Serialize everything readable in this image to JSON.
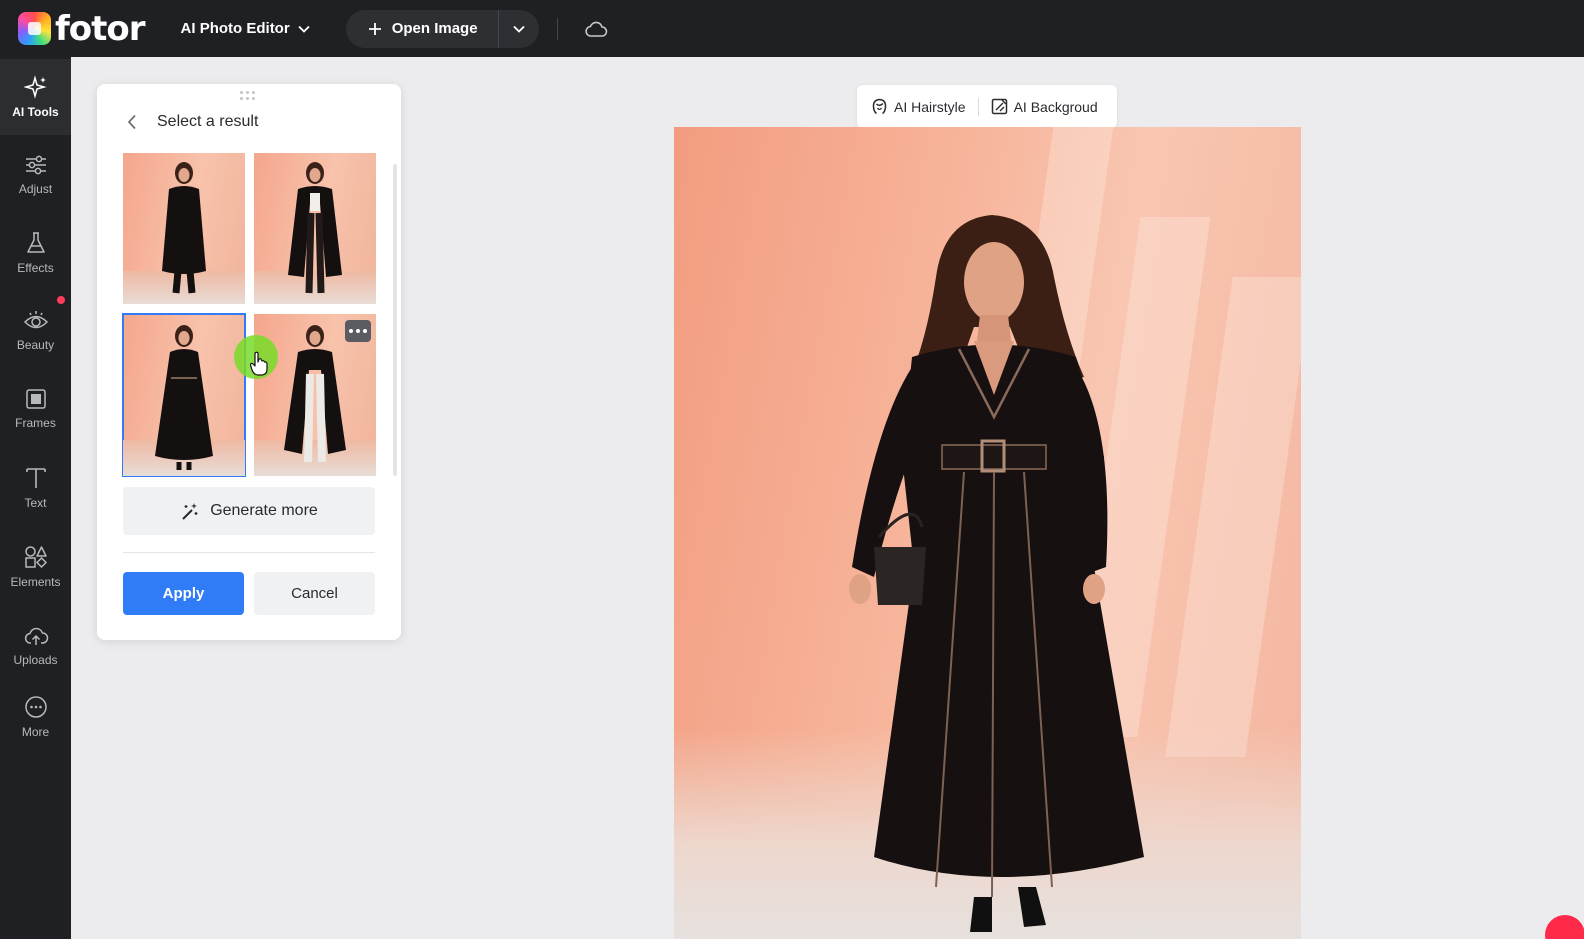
{
  "app": {
    "logo_text": "fotor",
    "editor_menu_label": "AI Photo Editor",
    "open_image_label": "Open Image"
  },
  "sidebar": {
    "items": [
      {
        "label": "AI Tools",
        "icon": "sparkle-icon",
        "active": true
      },
      {
        "label": "Adjust",
        "icon": "sliders-icon"
      },
      {
        "label": "Effects",
        "icon": "flask-icon"
      },
      {
        "label": "Beauty",
        "icon": "eye-icon",
        "badge": true
      },
      {
        "label": "Frames",
        "icon": "frame-icon"
      },
      {
        "label": "Text",
        "icon": "text-icon"
      },
      {
        "label": "Elements",
        "icon": "shapes-icon"
      },
      {
        "label": "Uploads",
        "icon": "cloud-upload-icon"
      },
      {
        "label": "More",
        "icon": "more-circle-icon"
      }
    ]
  },
  "panel": {
    "title": "Select a result",
    "results": [
      {
        "variant": "long black coat, dark trousers",
        "selected": false
      },
      {
        "variant": "open black coat, white top",
        "selected": false
      },
      {
        "variant": "belted black coat dress",
        "selected": true
      },
      {
        "variant": "black coat, white jeans",
        "selected": false,
        "has_more_menu": true
      }
    ],
    "generate_more_label": "Generate more",
    "apply_label": "Apply",
    "cancel_label": "Cancel"
  },
  "canvas": {
    "toolbar": [
      {
        "label": "AI Hairstyle",
        "icon": "hairstyle-icon"
      },
      {
        "label": "AI Backgroud",
        "icon": "background-edit-icon"
      }
    ]
  },
  "colors": {
    "topbar": "#1f2023",
    "accent": "#2f7cf6",
    "canvas_bg": "#ececee",
    "photo_peach": "#f7b59b",
    "badge_red": "#ff3d5a"
  }
}
